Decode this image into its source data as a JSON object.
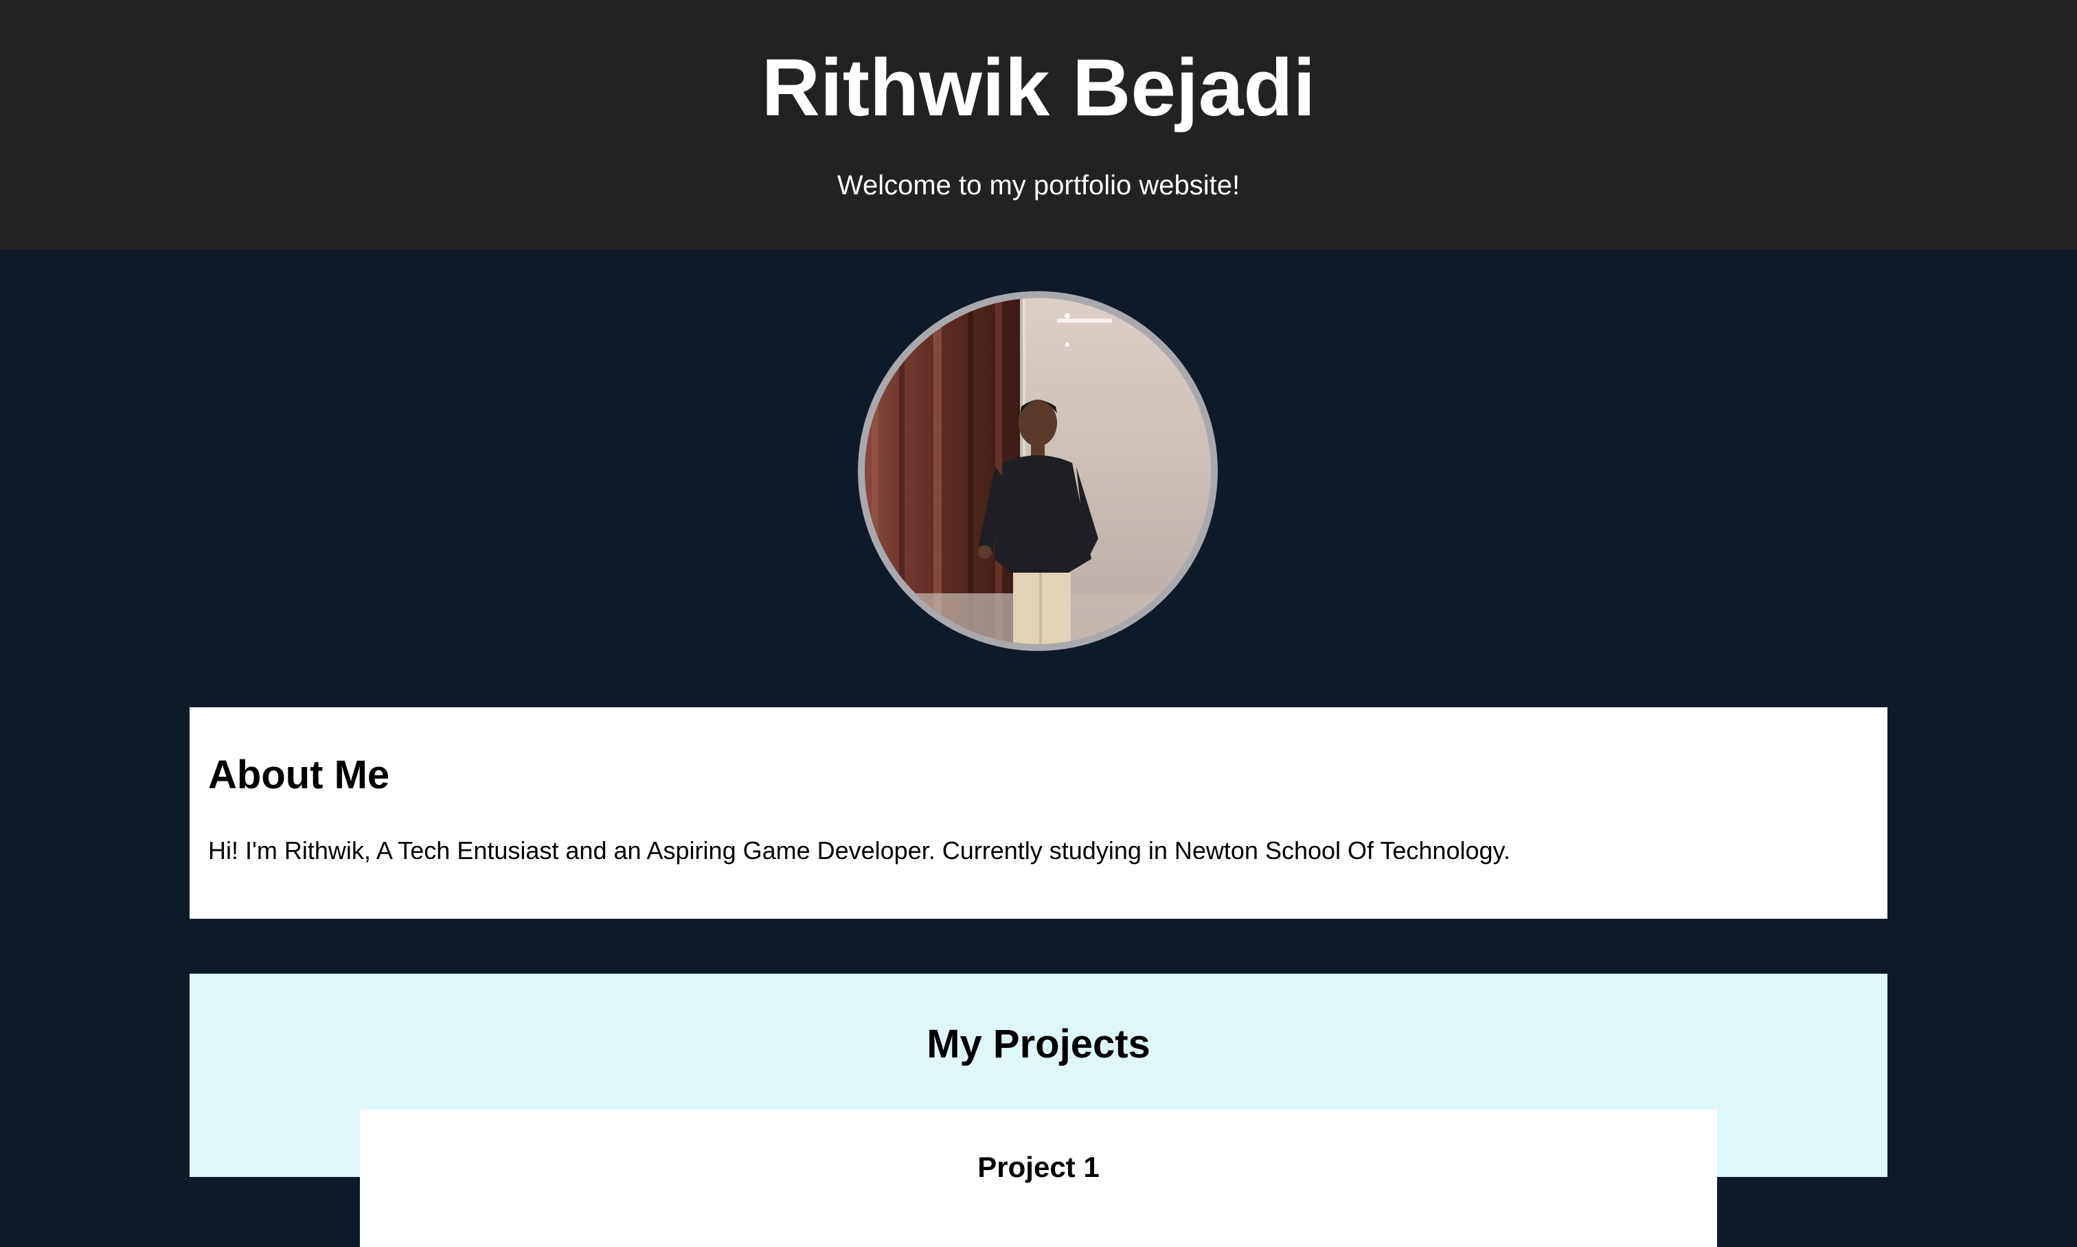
{
  "header": {
    "name": "Rithwik Bejadi",
    "tagline": "Welcome to my portfolio website!"
  },
  "profile": {
    "photo_alt": "Profile photo of Rithwik Bejadi"
  },
  "about": {
    "heading": "About Me",
    "text": "Hi! I'm Rithwik, A Tech Entusiast and an Aspiring Game Developer. Currently studying in Newton School Of Technology."
  },
  "projects": {
    "heading": "My Projects",
    "items": [
      {
        "title": "Project 1"
      }
    ]
  },
  "colors": {
    "header_bg": "#222222",
    "page_bg": "#0f1a28",
    "projects_bg": "#def7f8",
    "avatar_border": "#a9a9ad"
  }
}
